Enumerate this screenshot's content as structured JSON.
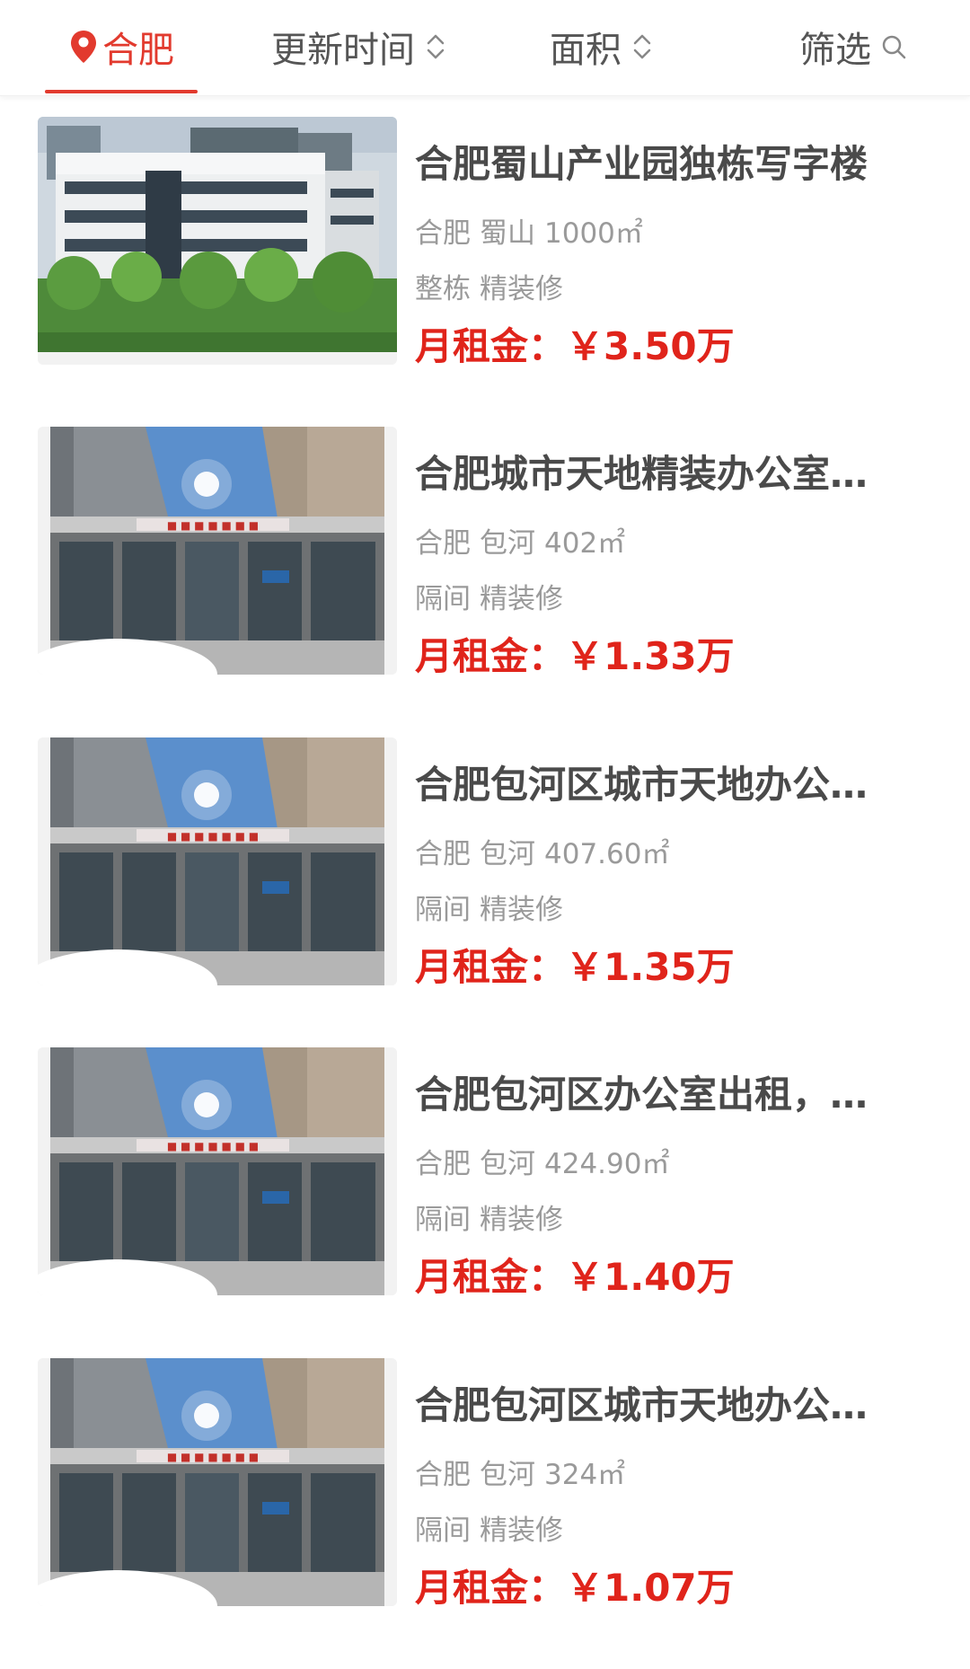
{
  "filter_bar": {
    "city": "合肥",
    "update_time": "更新时间",
    "area": "面积",
    "screen": "筛选"
  },
  "colors": {
    "accent": "#e23a2e",
    "price": "#e0241b",
    "title": "#4a4a4a",
    "meta": "#9a9a9a"
  },
  "listings": [
    {
      "title": "合肥蜀山产业园独栋写字楼",
      "city": "合肥",
      "district": "蜀山",
      "area": "1000㎡",
      "type": "整栋",
      "decoration": "精装修",
      "rent_label": "月租金：",
      "rent_value": "￥3.50万"
    },
    {
      "title": "合肥城市天地精装办公室出租",
      "city": "合肥",
      "district": "包河",
      "area": "402㎡",
      "type": "隔间",
      "decoration": "精装修",
      "rent_label": "月租金：",
      "rent_value": "￥1.33万"
    },
    {
      "title": "合肥包河区城市天地办公室出租",
      "city": "合肥",
      "district": "包河",
      "area": "407.60㎡",
      "type": "隔间",
      "decoration": "精装修",
      "rent_label": "月租金：",
      "rent_value": "￥1.35万"
    },
    {
      "title": "合肥包河区办公室出租，精装修",
      "city": "合肥",
      "district": "包河",
      "area": "424.90㎡",
      "type": "隔间",
      "decoration": "精装修",
      "rent_label": "月租金：",
      "rent_value": "￥1.40万"
    },
    {
      "title": "合肥包河区城市天地办公室出租",
      "city": "合肥",
      "district": "包河",
      "area": "324㎡",
      "type": "隔间",
      "decoration": "精装修",
      "rent_label": "月租金：",
      "rent_value": "￥1.07万"
    }
  ]
}
